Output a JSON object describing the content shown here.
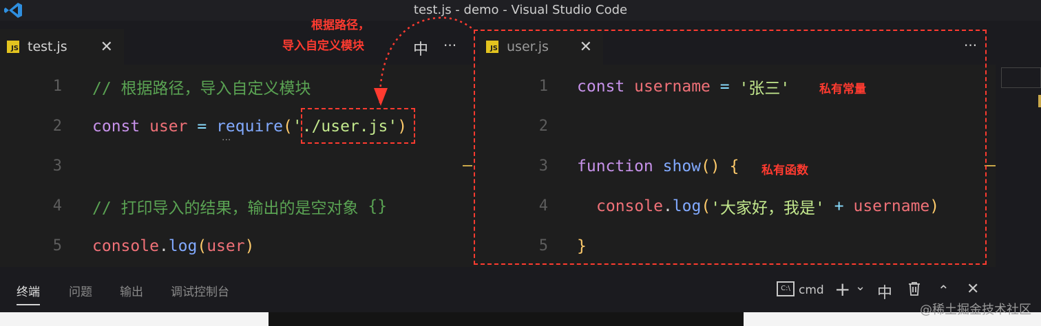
{
  "window": {
    "title": "test.js - demo - Visual Studio Code"
  },
  "left_editor": {
    "tab": {
      "label": "test.js",
      "icon": "JS",
      "close": "✕"
    },
    "actions": {
      "split": "中",
      "more": "···"
    },
    "lines": [
      {
        "num": "1",
        "comment": "// 根据路径，导入自定义模块"
      },
      {
        "num": "2",
        "kw": "const",
        "var": "user",
        "op": "=",
        "fn": "require",
        "paren_open": "(",
        "str": "'./user.js'",
        "paren_close": ")",
        "hint": "···"
      },
      {
        "num": "3"
      },
      {
        "num": "4",
        "comment": "// 打印导入的结果，输出的是空对象",
        "brace": "{}"
      },
      {
        "num": "5",
        "obj": "console",
        "dot": ".",
        "fn": "log",
        "paren_open": "(",
        "arg": "user",
        "paren_close": ")"
      }
    ]
  },
  "right_editor": {
    "tab": {
      "label": "user.js",
      "icon": "JS",
      "close": "✕"
    },
    "actions": {
      "more": "···"
    },
    "lines": [
      {
        "num": "1",
        "kw": "const",
        "var": "username",
        "op": "=",
        "str": "'张三'"
      },
      {
        "num": "2"
      },
      {
        "num": "3",
        "kw": "function",
        "fn": "show",
        "parens": "()",
        "brace": "{"
      },
      {
        "num": "4",
        "obj": "console",
        "dot": ".",
        "fn": "log",
        "paren_open": "(",
        "str": "'大家好，我是'",
        "op": "+",
        "arg": "username",
        "paren_close": ")"
      },
      {
        "num": "5",
        "brace": "}"
      }
    ]
  },
  "annotations": {
    "top_line1": "根据路径，",
    "top_line2": "导入自定义模块",
    "private_const": "私有常量",
    "private_fn": "私有函数"
  },
  "panel": {
    "tabs": [
      "终端",
      "问题",
      "输出",
      "调试控制台"
    ],
    "active_tab": "终端",
    "terminal_label": "cmd",
    "icons": {
      "add": "+",
      "dropdown": "⌄",
      "split": "中",
      "trash": "🗑",
      "maximize": "⌃",
      "close": "✕"
    }
  },
  "watermark": "@稀土掘金技术社区",
  "colors": {
    "annotation": "#ff3b30",
    "js_icon": "#e3c41f",
    "comment": "#5aa353"
  }
}
